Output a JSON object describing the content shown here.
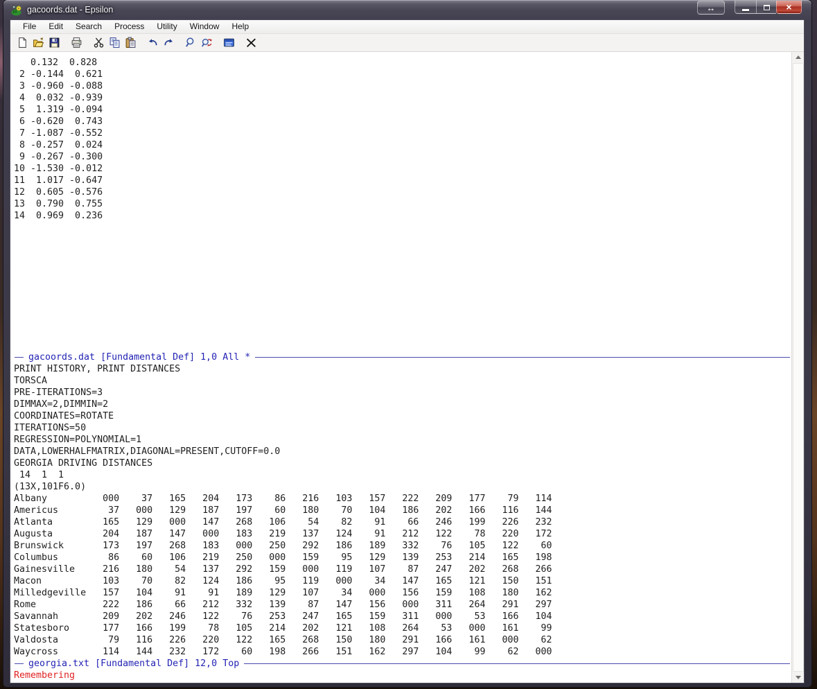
{
  "window": {
    "title": "gacoords.dat - Epsilon"
  },
  "menu": {
    "items": [
      "File",
      "Edit",
      "Search",
      "Process",
      "Utility",
      "Window",
      "Help"
    ]
  },
  "toolbar": {
    "icons": [
      "new-file",
      "open-folder",
      "save",
      "print",
      "cut",
      "copy",
      "paste",
      "undo",
      "redo",
      "search",
      "search-replace",
      "commands-window",
      "delete"
    ]
  },
  "editor": {
    "top_buffer": {
      "lines": [
        "   0.132  0.828",
        " 2 -0.144  0.621",
        " 3 -0.960 -0.088",
        " 4  0.032 -0.939",
        " 5  1.319 -0.094",
        " 6 -0.620  0.743",
        " 7 -1.087 -0.552",
        " 8 -0.257  0.024",
        " 9 -0.267 -0.300",
        "10 -1.530 -0.012",
        "11  1.017 -0.647",
        "12  0.605 -0.576",
        "13  0.790  0.755",
        "14  0.969  0.236"
      ]
    },
    "top_modeline": {
      "text": "gacoords.dat [Fundamental Def] 1,0 All *"
    },
    "bottom_buffer": {
      "header_lines": [
        "PRINT HISTORY, PRINT DISTANCES",
        "TORSCA",
        "PRE-ITERATIONS=3",
        "DIMMAX=2,DIMMIN=2",
        "COORDINATES=ROTATE",
        "ITERATIONS=50",
        "REGRESSION=POLYNOMIAL=1",
        "DATA,LOWERHALFMATRIX,DIAGONAL=PRESENT,CUTOFF=0.0",
        "GEORGIA DRIVING DISTANCES",
        " 14  1  1",
        "(13X,101F6.0)"
      ],
      "distance_table": {
        "rows": [
          {
            "name": "Albany",
            "values": [
              "000",
              "37",
              "165",
              "204",
              "173",
              "86",
              "216",
              "103",
              "157",
              "222",
              "209",
              "177",
              "79",
              "114"
            ]
          },
          {
            "name": "Americus",
            "values": [
              "37",
              "000",
              "129",
              "187",
              "197",
              "60",
              "180",
              "70",
              "104",
              "186",
              "202",
              "166",
              "116",
              "144"
            ]
          },
          {
            "name": "Atlanta",
            "values": [
              "165",
              "129",
              "000",
              "147",
              "268",
              "106",
              "54",
              "82",
              "91",
              "66",
              "246",
              "199",
              "226",
              "232"
            ]
          },
          {
            "name": "Augusta",
            "values": [
              "204",
              "187",
              "147",
              "000",
              "183",
              "219",
              "137",
              "124",
              "91",
              "212",
              "122",
              "78",
              "220",
              "172"
            ]
          },
          {
            "name": "Brunswick",
            "values": [
              "173",
              "197",
              "268",
              "183",
              "000",
              "250",
              "292",
              "186",
              "189",
              "332",
              "76",
              "105",
              "122",
              "60"
            ]
          },
          {
            "name": "Columbus",
            "values": [
              "86",
              "60",
              "106",
              "219",
              "250",
              "000",
              "159",
              "95",
              "129",
              "139",
              "253",
              "214",
              "165",
              "198"
            ]
          },
          {
            "name": "Gainesville",
            "values": [
              "216",
              "180",
              "54",
              "137",
              "292",
              "159",
              "000",
              "119",
              "107",
              "87",
              "247",
              "202",
              "268",
              "266"
            ]
          },
          {
            "name": "Macon",
            "values": [
              "103",
              "70",
              "82",
              "124",
              "186",
              "95",
              "119",
              "000",
              "34",
              "147",
              "165",
              "121",
              "150",
              "151"
            ]
          },
          {
            "name": "Milledgeville",
            "values": [
              "157",
              "104",
              "91",
              "91",
              "189",
              "129",
              "107",
              "34",
              "000",
              "156",
              "159",
              "108",
              "180",
              "162"
            ]
          },
          {
            "name": "Rome",
            "values": [
              "222",
              "186",
              "66",
              "212",
              "332",
              "139",
              "87",
              "147",
              "156",
              "000",
              "311",
              "264",
              "291",
              "297"
            ]
          },
          {
            "name": "Savannah",
            "values": [
              "209",
              "202",
              "246",
              "122",
              "76",
              "253",
              "247",
              "165",
              "159",
              "311",
              "000",
              "53",
              "166",
              "104"
            ]
          },
          {
            "name": "Statesboro",
            "values": [
              "177",
              "166",
              "199",
              "78",
              "105",
              "214",
              "202",
              "121",
              "108",
              "264",
              "53",
              "000",
              "161",
              "99"
            ]
          },
          {
            "name": "Valdosta",
            "values": [
              "79",
              "116",
              "226",
              "220",
              "122",
              "165",
              "268",
              "150",
              "180",
              "291",
              "166",
              "161",
              "000",
              "62"
            ]
          },
          {
            "name": "Waycross",
            "values": [
              "114",
              "144",
              "232",
              "172",
              "60",
              "198",
              "266",
              "151",
              "162",
              "297",
              "104",
              "99",
              "62",
              "000"
            ]
          }
        ]
      }
    },
    "bottom_modeline": {
      "text": "georgia.txt [Fundamental Def] 12,0 Top"
    },
    "status_message": "Remembering"
  },
  "colors": {
    "modeline_text": "#2323b4",
    "modeline_line": "#4a4aae",
    "status_message": "#e02222",
    "titlebar": "#3b3848",
    "close_button": "#c1483a"
  }
}
